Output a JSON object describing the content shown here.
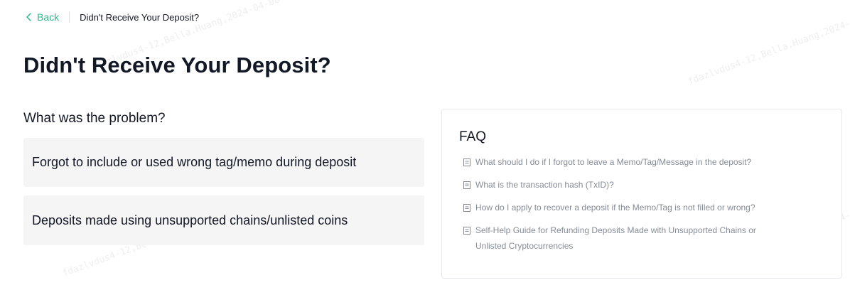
{
  "breadcrumb": {
    "back_label": "Back",
    "current": "Didn't Receive Your Deposit?"
  },
  "page": {
    "title": "Didn't Receive Your Deposit?"
  },
  "problem": {
    "heading": "What was the problem?",
    "options": [
      {
        "label": "Forgot to include or used wrong tag/memo during deposit"
      },
      {
        "label": "Deposits made using unsupported chains/unlisted coins"
      }
    ]
  },
  "faq": {
    "title": "FAQ",
    "items": [
      {
        "label": "What should I do if I forgot to leave a Memo/Tag/Message in the deposit?",
        "icon": "document-icon"
      },
      {
        "label": "What is the transaction hash (TxID)?",
        "icon": "document-icon"
      },
      {
        "label": "How do I apply to recover a deposit if the Memo/Tag is not filled or wrong?",
        "icon": "document-icon"
      },
      {
        "label": "Self-Help Guide for Refunding Deposits Made with Unsupported Chains or Unlisted Cryptocurrencies",
        "icon": "document-icon"
      }
    ]
  },
  "watermark": {
    "text": "fdazlvdus4-12,Bella.Huang,2024-04-08"
  },
  "colors": {
    "accent": "#2db88a",
    "text": "#121826",
    "muted": "#858c96",
    "option_bg": "#f5f5f5",
    "border": "#e6e8eb"
  }
}
